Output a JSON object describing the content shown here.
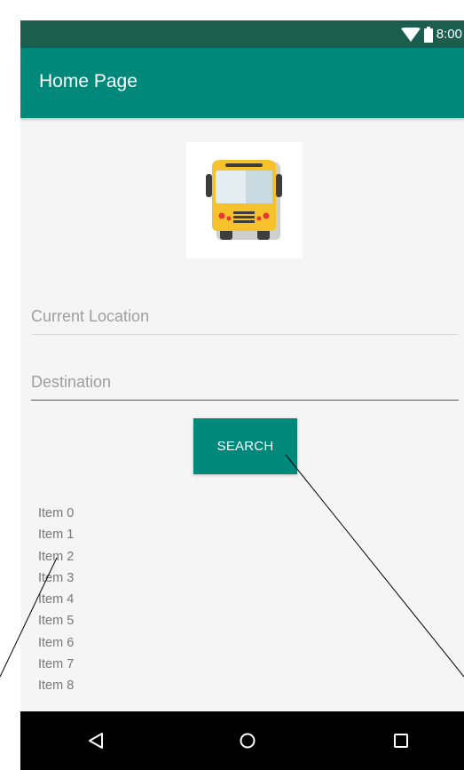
{
  "status_bar": {
    "time": "8:00",
    "icons": [
      "wifi-icon",
      "battery-icon"
    ]
  },
  "app_bar": {
    "title": "Home Page"
  },
  "logo": {
    "icon": "bus-icon",
    "colors": {
      "body": "#f6c22b",
      "trim": "#4a4a4a",
      "window": "#e4eef2",
      "lights": "#e53935"
    }
  },
  "form": {
    "current_location_placeholder": "Current Location",
    "current_location_value": "",
    "destination_placeholder": "Destination",
    "destination_value": "",
    "search_label": "SEARCH"
  },
  "list": {
    "items": [
      "Item 0",
      "Item 1",
      "Item 2",
      "Item 3",
      "Item 4",
      "Item 5",
      "Item 6",
      "Item 7",
      "Item 8"
    ]
  },
  "nav_bar": {
    "icons": [
      "back-icon",
      "home-icon",
      "recents-icon"
    ]
  },
  "theme": {
    "primary": "#00897b",
    "primary_dark": "#1b5e4f",
    "background": "#f5f5f5"
  }
}
